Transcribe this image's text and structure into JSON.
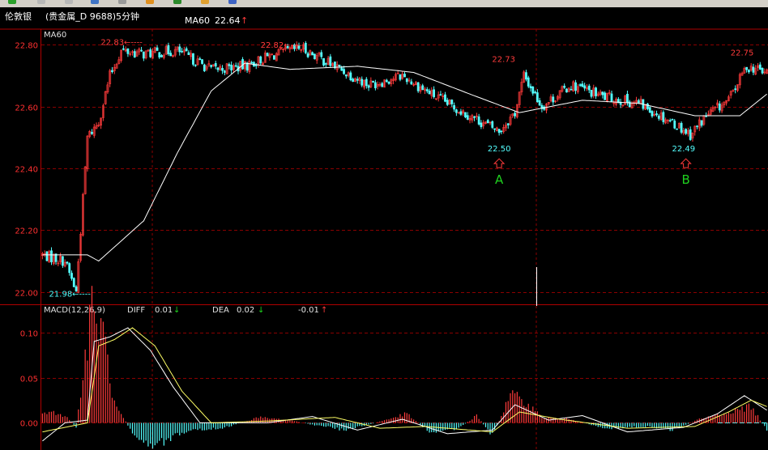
{
  "header": {
    "app_name": "伦敦银",
    "instrument": "(贵金属_D 9688)5分钟",
    "ma_label": "MA60",
    "ma_value": "22.64",
    "ma_arrow": "↑"
  },
  "colors": {
    "background": "#000000",
    "frame": "#b00000",
    "grid": "#8b0000",
    "up": "#ff3b3b",
    "down": "#54ffff",
    "ma_line": "#ffffff",
    "dea_line": "#ffff66",
    "label_gray": "#c0c0c0",
    "axis_red": "#ff3030",
    "marker_green": "#1fd11f"
  },
  "chart_data": [
    {
      "type": "line",
      "title": "MA60",
      "price_axis": {
        "ticks": [
          "22.80",
          "22.60",
          "22.40",
          "22.20",
          "22.00"
        ],
        "ylim": [
          21.96,
          22.85
        ]
      },
      "grid": true,
      "price_series": [
        {
          "i": 0,
          "close": 22.12
        },
        {
          "i": 10,
          "close": 22.1
        },
        {
          "i": 15,
          "close": 22.0
        },
        {
          "i": 20,
          "close": 22.5
        },
        {
          "i": 25,
          "close": 22.55
        },
        {
          "i": 30,
          "close": 22.7
        },
        {
          "i": 35,
          "close": 22.78
        },
        {
          "i": 45,
          "close": 22.77
        },
        {
          "i": 60,
          "close": 22.78
        },
        {
          "i": 75,
          "close": 22.72
        },
        {
          "i": 90,
          "close": 22.73
        },
        {
          "i": 100,
          "close": 22.76
        },
        {
          "i": 115,
          "close": 22.79
        },
        {
          "i": 130,
          "close": 22.73
        },
        {
          "i": 145,
          "close": 22.67
        },
        {
          "i": 160,
          "close": 22.7
        },
        {
          "i": 175,
          "close": 22.63
        },
        {
          "i": 190,
          "close": 22.57
        },
        {
          "i": 203,
          "close": 22.52
        },
        {
          "i": 210,
          "close": 22.58
        },
        {
          "i": 214,
          "close": 22.7
        },
        {
          "i": 222,
          "close": 22.6
        },
        {
          "i": 235,
          "close": 22.67
        },
        {
          "i": 250,
          "close": 22.63
        },
        {
          "i": 265,
          "close": 22.61
        },
        {
          "i": 280,
          "close": 22.55
        },
        {
          "i": 288,
          "close": 22.51
        },
        {
          "i": 295,
          "close": 22.57
        },
        {
          "i": 305,
          "close": 22.62
        },
        {
          "i": 313,
          "close": 22.73
        },
        {
          "i": 322,
          "close": 22.71
        }
      ],
      "ma_series": [
        {
          "i": 0,
          "v": 22.12
        },
        {
          "i": 20,
          "v": 22.12
        },
        {
          "i": 25,
          "v": 22.1
        },
        {
          "i": 45,
          "v": 22.23
        },
        {
          "i": 60,
          "v": 22.45
        },
        {
          "i": 75,
          "v": 22.65
        },
        {
          "i": 90,
          "v": 22.74
        },
        {
          "i": 110,
          "v": 22.72
        },
        {
          "i": 140,
          "v": 22.73
        },
        {
          "i": 165,
          "v": 22.71
        },
        {
          "i": 190,
          "v": 22.64
        },
        {
          "i": 212,
          "v": 22.58
        },
        {
          "i": 240,
          "v": 22.62
        },
        {
          "i": 265,
          "v": 22.61
        },
        {
          "i": 290,
          "v": 22.57
        },
        {
          "i": 310,
          "v": 22.57
        },
        {
          "i": 322,
          "v": 22.64
        }
      ],
      "annotations": [
        {
          "text": "22.83←----",
          "i": 25,
          "price": 22.81,
          "color": "up",
          "align": "left"
        },
        {
          "text": "22.82←----",
          "i": 96,
          "price": 22.8,
          "color": "up",
          "align": "left"
        },
        {
          "text": "21.98←----",
          "i": 2,
          "price": 21.995,
          "color": "down",
          "align": "left"
        },
        {
          "text": "22.73",
          "i": 205,
          "price": 22.755,
          "color": "up",
          "align": "center"
        },
        {
          "text": "22.50",
          "i": 203,
          "price": 22.465,
          "color": "down",
          "align": "center"
        },
        {
          "text": "22.49",
          "i": 285,
          "price": 22.465,
          "color": "down",
          "align": "center"
        },
        {
          "text": "22.75",
          "i": 311,
          "price": 22.775,
          "color": "up",
          "align": "center"
        }
      ],
      "markers": [
        {
          "label": "A",
          "i": 203
        },
        {
          "label": "B",
          "i": 286
        }
      ]
    },
    {
      "type": "bar",
      "title": "MACD(12,26,9)",
      "indicators": {
        "diff_label": "DIFF",
        "diff_value": "0.01",
        "diff_arrow": "↓",
        "dea_label": "DEA",
        "dea_value": "0.02",
        "dea_arrow": "↓",
        "macd_value": "-0.01",
        "macd_arrow": "↑"
      },
      "y_axis": {
        "ticks": [
          "0.10",
          "0.05",
          "0.00"
        ],
        "ylim": [
          -0.03,
          0.13
        ]
      },
      "grid": true,
      "series": [
        {
          "name": "DIFF",
          "points": [
            {
              "i": 0,
              "v": -0.02
            },
            {
              "i": 10,
              "v": 0.0
            },
            {
              "i": 20,
              "v": 0.003
            },
            {
              "i": 23,
              "v": 0.09
            },
            {
              "i": 30,
              "v": 0.095
            },
            {
              "i": 38,
              "v": 0.105
            },
            {
              "i": 48,
              "v": 0.08
            },
            {
              "i": 58,
              "v": 0.04
            },
            {
              "i": 70,
              "v": 0.0
            },
            {
              "i": 100,
              "v": 0.0
            },
            {
              "i": 120,
              "v": 0.007
            },
            {
              "i": 140,
              "v": -0.008
            },
            {
              "i": 160,
              "v": 0.004
            },
            {
              "i": 180,
              "v": -0.012
            },
            {
              "i": 200,
              "v": -0.008
            },
            {
              "i": 210,
              "v": 0.02
            },
            {
              "i": 225,
              "v": 0.003
            },
            {
              "i": 240,
              "v": 0.008
            },
            {
              "i": 260,
              "v": -0.01
            },
            {
              "i": 285,
              "v": -0.005
            },
            {
              "i": 300,
              "v": 0.01
            },
            {
              "i": 312,
              "v": 0.03
            },
            {
              "i": 322,
              "v": 0.014
            }
          ]
        },
        {
          "name": "DEA",
          "points": [
            {
              "i": 0,
              "v": -0.01
            },
            {
              "i": 20,
              "v": 0.0
            },
            {
              "i": 25,
              "v": 0.085
            },
            {
              "i": 32,
              "v": 0.092
            },
            {
              "i": 40,
              "v": 0.105
            },
            {
              "i": 50,
              "v": 0.085
            },
            {
              "i": 62,
              "v": 0.035
            },
            {
              "i": 75,
              "v": 0.0
            },
            {
              "i": 100,
              "v": 0.002
            },
            {
              "i": 130,
              "v": 0.006
            },
            {
              "i": 150,
              "v": -0.006
            },
            {
              "i": 170,
              "v": -0.004
            },
            {
              "i": 200,
              "v": -0.01
            },
            {
              "i": 212,
              "v": 0.012
            },
            {
              "i": 230,
              "v": 0.004
            },
            {
              "i": 260,
              "v": -0.006
            },
            {
              "i": 290,
              "v": -0.004
            },
            {
              "i": 305,
              "v": 0.012
            },
            {
              "i": 315,
              "v": 0.025
            },
            {
              "i": 322,
              "v": 0.018
            }
          ]
        },
        {
          "name": "MACD",
          "points": [
            {
              "i": 0,
              "v": 0.01
            },
            {
              "i": 5,
              "v": 0.012
            },
            {
              "i": 10,
              "v": 0.008
            },
            {
              "i": 15,
              "v": -0.005
            },
            {
              "i": 22,
              "v": 0.125
            },
            {
              "i": 27,
              "v": 0.1
            },
            {
              "i": 32,
              "v": 0.02
            },
            {
              "i": 40,
              "v": -0.01
            },
            {
              "i": 48,
              "v": -0.025
            },
            {
              "i": 55,
              "v": -0.02
            },
            {
              "i": 65,
              "v": -0.008
            },
            {
              "i": 80,
              "v": -0.006
            },
            {
              "i": 96,
              "v": 0.006
            },
            {
              "i": 110,
              "v": 0.003
            },
            {
              "i": 120,
              "v": -0.002
            },
            {
              "i": 135,
              "v": -0.008
            },
            {
              "i": 148,
              "v": 0.0
            },
            {
              "i": 162,
              "v": 0.01
            },
            {
              "i": 172,
              "v": -0.01
            },
            {
              "i": 185,
              "v": -0.006
            },
            {
              "i": 193,
              "v": 0.008
            },
            {
              "i": 200,
              "v": -0.014
            },
            {
              "i": 208,
              "v": 0.03
            },
            {
              "i": 214,
              "v": 0.025
            },
            {
              "i": 222,
              "v": 0.006
            },
            {
              "i": 235,
              "v": 0.004
            },
            {
              "i": 250,
              "v": -0.006
            },
            {
              "i": 268,
              "v": -0.004
            },
            {
              "i": 280,
              "v": -0.008
            },
            {
              "i": 292,
              "v": 0.004
            },
            {
              "i": 305,
              "v": 0.012
            },
            {
              "i": 315,
              "v": 0.018
            },
            {
              "i": 322,
              "v": -0.008
            }
          ]
        }
      ]
    }
  ]
}
